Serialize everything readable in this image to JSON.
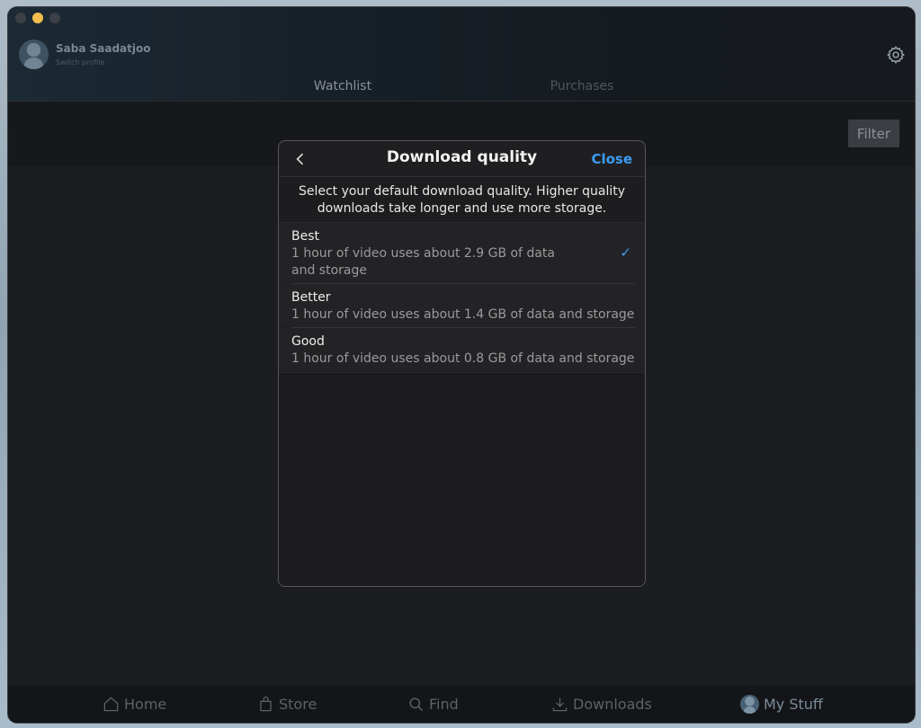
{
  "profile": {
    "name": "Saba Saadatjoo",
    "subtitle": "Switch profile"
  },
  "tabs": [
    {
      "label": "Watchlist",
      "active": true
    },
    {
      "label": "Purchases",
      "active": false
    }
  ],
  "filter_label": "Filter",
  "dialog": {
    "title": "Download quality",
    "close_label": "Close",
    "description": "Select your default download quality. Higher quality downloads take longer and use more storage.",
    "options": [
      {
        "label": "Best",
        "description": "1 hour of video uses about 2.9 GB of data and storage",
        "selected": true
      },
      {
        "label": "Better",
        "description": "1 hour of video uses about 1.4 GB of data and storage",
        "selected": false
      },
      {
        "label": "Good",
        "description": "1 hour of video uses about 0.8 GB of data and storage",
        "selected": false
      }
    ],
    "check_glyph": "✓"
  },
  "bottom_nav": [
    {
      "label": "Home",
      "icon": "home-icon"
    },
    {
      "label": "Store",
      "icon": "store-icon"
    },
    {
      "label": "Find",
      "icon": "search-icon"
    },
    {
      "label": "Downloads",
      "icon": "download-icon"
    },
    {
      "label": "My Stuff",
      "icon": "profile-avatar-icon",
      "active": true
    }
  ],
  "colors": {
    "accent": "#3d9bf2",
    "window_bg": "#1b1d20",
    "dialog_bg": "#1f1f21"
  }
}
